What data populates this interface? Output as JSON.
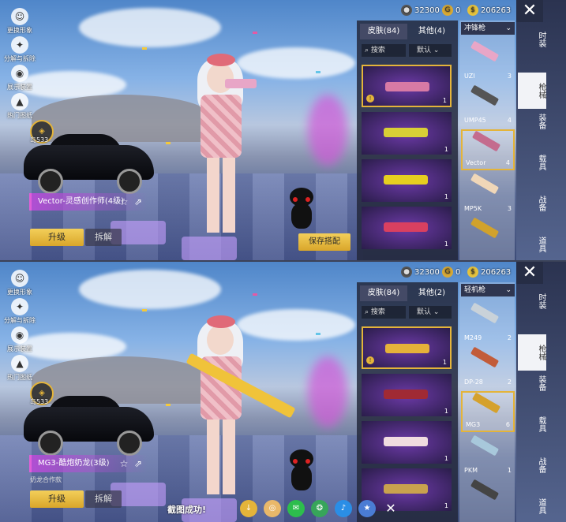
{
  "panels": [
    {
      "currency": {
        "silver": "32300",
        "gold": "0",
        "coupon": "206263"
      },
      "left_menu": [
        "更换形象",
        "分解与拆除",
        "展示装置",
        "热门图纸"
      ],
      "badge_label": "岛533",
      "skin_title": "Vector-灵感创作师(4级)",
      "subtitle": "",
      "upgrade_label": "升级",
      "dismantle_label": "拆解",
      "save_label": "保存搭配",
      "tabs": {
        "skins": "皮肤(84)",
        "other": "其他(4)"
      },
      "search_placeholder": "搜索",
      "sort_label": "默认",
      "category_dropdown": "冲锋枪",
      "categories": [
        {
          "name": "UZI",
          "count": "3",
          "color": "#e8a6c7"
        },
        {
          "name": "UMP45",
          "count": "4",
          "color": "#555"
        },
        {
          "name": "Vector",
          "count": "4",
          "color": "#c46c8e"
        },
        {
          "name": "MP5K",
          "count": "3",
          "color": "#f0d7b8"
        },
        {
          "name": "",
          "count": "",
          "color": "#d1a22c"
        }
      ],
      "skins": [
        {
          "count": "1",
          "color": "#d77aa5",
          "selected": true
        },
        {
          "count": "1",
          "color": "#d8cf36",
          "selected": false
        },
        {
          "count": "1",
          "color": "#e6cf20",
          "selected": false
        },
        {
          "count": "1",
          "color": "#d94060",
          "selected": false
        }
      ],
      "held_gun_color": "#e8a6c7"
    },
    {
      "currency": {
        "silver": "32300",
        "gold": "0",
        "coupon": "206263"
      },
      "left_menu": [
        "更换形象",
        "分解与拆除",
        "展示装置",
        "热门图纸"
      ],
      "badge_label": "岛533",
      "skin_title": "MG3-酷炮奶龙(3级)",
      "subtitle": "奶龙合作款",
      "upgrade_label": "升级",
      "dismantle_label": "拆解",
      "save_label": "",
      "tabs": {
        "skins": "皮肤(84)",
        "other": "其他(2)"
      },
      "search_placeholder": "搜索",
      "sort_label": "默认",
      "category_dropdown": "轻机枪",
      "categories": [
        {
          "name": "M249",
          "count": "2",
          "color": "#c9d2d9"
        },
        {
          "name": "DP-28",
          "count": "2",
          "color": "#c25c3a"
        },
        {
          "name": "MG3",
          "count": "6",
          "color": "#d5a12c"
        },
        {
          "name": "PKM",
          "count": "1",
          "color": "#a8c8db"
        },
        {
          "name": "",
          "count": "",
          "color": "#444"
        }
      ],
      "skins": [
        {
          "count": "1",
          "color": "#e5b23a",
          "selected": true
        },
        {
          "count": "1",
          "color": "#a02a34",
          "selected": false
        },
        {
          "count": "1",
          "color": "#f0dce0",
          "selected": false
        },
        {
          "count": "1",
          "color": "#c9a24e",
          "selected": false
        }
      ],
      "held_gun_color": "#f0c33a"
    }
  ],
  "right_nav": [
    "时装",
    "枪械",
    "装备",
    "载具",
    "战备",
    "道具"
  ],
  "share_bar": {
    "label": "截图成功!"
  }
}
